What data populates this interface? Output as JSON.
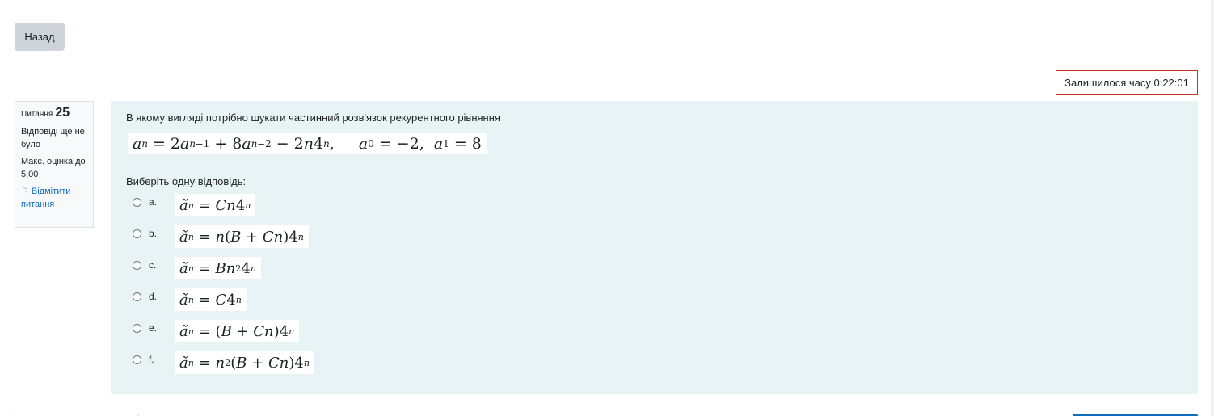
{
  "nav": {
    "back_label": "Назад"
  },
  "timer": {
    "text": "Залишилося часу 0:22:01"
  },
  "info": {
    "question_label": "Питання",
    "question_number": "25",
    "status": "Відповіді ще не було",
    "max_grade": "Макс. оцінка до 5,00",
    "flag_label": "Відмітити питання"
  },
  "question": {
    "text": "В якому вигляді потрібно шукати частинний розв'язок рекурентного рівняння",
    "formula": "a_n = 2a_{n-1} + 8a_{n-2} - 2n4^n,  a_0 = -2,  a_1 = 8",
    "prompt": "Виберіть одну відповідь:",
    "options": [
      {
        "letter": "a.",
        "formula": "ã_n = Cn4^n"
      },
      {
        "letter": "b.",
        "formula": "ã_n = n(B + Cn)4^n"
      },
      {
        "letter": "c.",
        "formula": "ã_n = Bn^2 4^n"
      },
      {
        "letter": "d.",
        "formula": "ã_n = C4^n"
      },
      {
        "letter": "e.",
        "formula": "ã_n = (B + Cn)4^n"
      },
      {
        "letter": "f.",
        "formula": "ã_n = n^2(B + Cn)4^n"
      }
    ]
  },
  "icons": {
    "flag": "flag-icon",
    "radio": "radio-button"
  },
  "colors": {
    "timer_border": "#ca3120",
    "question_bg": "#e7f3f5",
    "link": "#0f6cbf"
  }
}
